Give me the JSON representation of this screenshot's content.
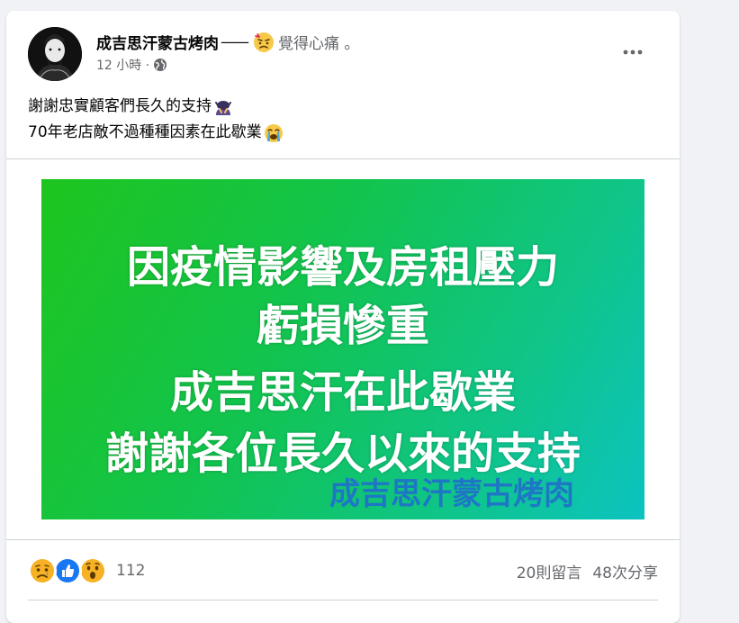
{
  "post": {
    "author": "成吉思汗蒙古烤肉",
    "dash": "——",
    "feeling": "覺得心痛 。",
    "time": "12 小時 ·",
    "privacy_icon": "globe-icon",
    "more_icon": "more-dots-icon",
    "text_line1": "謝謝忠實顧客們長久的支持",
    "text_line2": "70年老店敵不過種種因素在此歇業",
    "image": {
      "line1": "因疫情影響及房租壓力",
      "line2": "虧損慘重",
      "line3": "成吉思汗在此歇業",
      "line4": "謝謝各位長久以來的支持",
      "signature": "成吉思汗蒙古烤肉",
      "gradient_start": "#1ec51e",
      "gradient_end": "#0cc3c0"
    },
    "reactions": {
      "icons": [
        "sad-reaction-icon",
        "like-reaction-icon",
        "wow-reaction-icon"
      ],
      "count": "112"
    },
    "comments": "20則留言",
    "shares": "48次分享"
  },
  "colors": {
    "background": "#f0f2f5",
    "card": "#ffffff",
    "secondary_text": "#65676b",
    "like_blue": "#1877f2",
    "emoji_yellow": "#f7b125"
  }
}
